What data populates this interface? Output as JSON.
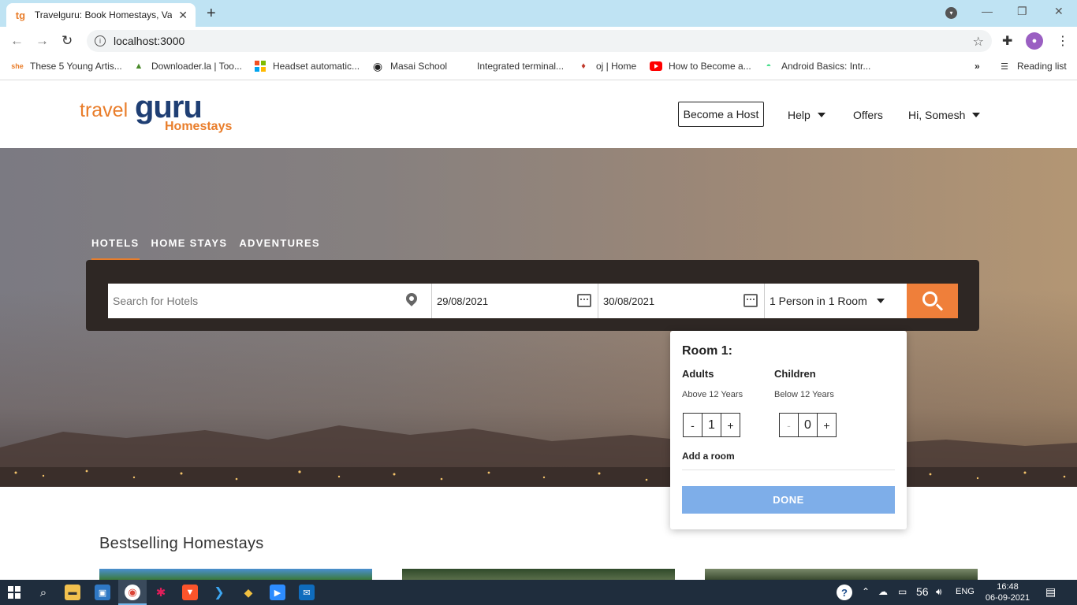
{
  "browser": {
    "tab_title": "Travelguru: Book Homestays, Vac",
    "favicon_text": "tg",
    "url": "localhost:3000",
    "bookmarks": [
      {
        "label": "These 5 Young Artis...",
        "icon": "she"
      },
      {
        "label": "Downloader.la | Too...",
        "icon": "dino"
      },
      {
        "label": "Headset automatic...",
        "icon": "ms"
      },
      {
        "label": "Masai School",
        "icon": "globe"
      },
      {
        "label": "Integrated terminal...",
        "icon": ""
      },
      {
        "label": "oj | Home",
        "icon": "pin"
      },
      {
        "label": "How to Become a...",
        "icon": "youtube"
      },
      {
        "label": "Android Basics: Intr...",
        "icon": "android"
      }
    ],
    "more_bookmarks": "»",
    "reading_list": "Reading list"
  },
  "header": {
    "logo_travel": "travel",
    "logo_guru": "guru",
    "logo_homestays": "Homestays",
    "become_host": "Become a Host",
    "help": "Help",
    "offers": "Offers",
    "user": "Hi, Somesh"
  },
  "search": {
    "tabs": [
      "HOTELS",
      "HOME STAYS",
      "ADVENTURES"
    ],
    "active_tab": "HOTELS",
    "placeholder": "Search for Hotels",
    "checkin": "29/08/2021",
    "checkout": "30/08/2021",
    "guests": "1 Person in 1 Room"
  },
  "room_popup": {
    "title": "Room 1:",
    "adults_label": "Adults",
    "adults_sub": "Above 12 Years",
    "adults_value": "1",
    "children_label": "Children",
    "children_sub": "Below 12 Years",
    "children_value": "0",
    "minus": "-",
    "plus": "+",
    "add_room": "Add a room",
    "done": "DONE"
  },
  "main": {
    "bestselling_title": "Bestselling Homestays"
  },
  "taskbar": {
    "temperature": "56",
    "language": "ENG",
    "time": "16:48",
    "date": "06-09-2021"
  },
  "colors": {
    "brand_orange": "#e97d2a",
    "brand_navy": "#1f3f74",
    "search_button": "#ef7f3a",
    "done_button": "#7eaee9",
    "search_panel": "#2e2724"
  }
}
